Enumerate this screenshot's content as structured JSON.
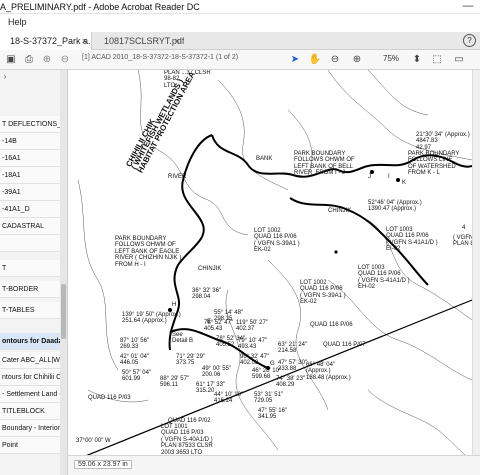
{
  "window": {
    "title": "A_PRELIMINARY.pdf - Adobe Acrobat Reader DC"
  },
  "menu": {
    "help": "Help"
  },
  "tabs": [
    {
      "label": "18-S-37372_Park a..."
    },
    {
      "label": "10817SCLSRYT.pdf"
    }
  ],
  "toolbar": {
    "doc_label": "[1] ACAD 2010_18-S-37372-18-S-37372-1 (1 of 2)",
    "zoom": "75%"
  },
  "bookmarks": [
    "T DEFLECTIONS_COO",
    "-14B",
    "-16A1",
    "-18A1",
    "-39A1",
    "-41A1_D",
    "CADASTRAL",
    "",
    "T",
    "T-BORDER",
    "T-TABLES",
    "ontours for Daadzai",
    "Cater ABC_ALL|Wat",
    "ntours for Chihilii C",
    "- Settlement Land -",
    "TITLEBLOCK",
    "Boundary - Interior",
    "Point"
  ],
  "map": {
    "labels": {
      "plan_top": "PLAN ...37 CLSR\n98-82\nLTO",
      "chihilii": "CHIHILII CHIK\n( WHITEFISH WETLANDS )\nHABITAT PROTECTION AREA",
      "bank": "BANK",
      "river": "RIVER",
      "chinjik": "CHINJIK",
      "chinjik2": "CHINJIK",
      "park_right_bank": "PARK BOUNDARY\nFOLLOWS OHWM OF\nLEFT BANK OF BELL\nRIVER  FROM I - J",
      "park_watershed": "PARK BOUNDARY\nFOLLOWS LINE\nOF WATERSHED\nFROM K - L",
      "park_eagle": "PARK BOUNDARY\nFOLLOWS OHWM OF\nLEFT BANK OF EAGLE\nRIVER ( CHIZHIN NJIK )\nFROM H - I",
      "lot1002": "LOT 1002\nQUAD 116 P/06\n( VGFN S-39A1 )\nEK-02",
      "lot1003": "LOT 1003\nQUAD 116 P/06\n( VGFN S-41A1/D )\nEI-02",
      "lot1003b": "LOT 1003\nQUAD 116 P/06\n( VGFN S-41A1/D )\nEH-02",
      "lot1002b": "LOT 1002\nQUAD 116 P/06\n( VGFN S-39A1 )\nEK-02",
      "lot1001": "LOT 1001\nQUAD 116 P/03\n( VGFN S-40A1/D )\nPLAN 87533 CLSR\n2003 3653 LTO",
      "quad116p06": "QUAD 116 P/06",
      "quad116p07": "QUAD 116 P/07",
      "quad116p03": "QUAD 116 P/03",
      "quad116p02": "QUAD 116 P/02",
      "lat_37": "37°00' 00\" W",
      "bearing1": "21°30' 34\" (Approx.)\n4847.83\n42.97",
      "bearing2": "52°46' 04\" (Approx.)\n1390.47 (Approx.)",
      "right_lot": "( VGFN\nPLAN 8138",
      "right_num": "4",
      "station_j": "J",
      "station_i": "I",
      "station_k": "K",
      "station_h": "H",
      "station_g": "G",
      "station_e": "E",
      "bearings_cluster": "139° 19' 50\" (Approx.)\n251.64 (Approx.)",
      "dist_a": "36° 32' 36\"\n298.04",
      "dist_b": "55° 14' 48\"\n298.15",
      "dist_c": "78° 52' 47\"\n405.43",
      "dist_d": "119° 50' 27\"\n402.37",
      "dist_e": "87° 10' 56\"\n269.33",
      "dist_f": "42° 01' 04\"\n446.05",
      "dist_g": "50° 57' 04\"\n601.99",
      "dist_h": "71° 29' 29\"\n373.75",
      "dist_i": "49° 00' 55\"\n200.06",
      "dist_j": "61° 17' 33\"\n315.20",
      "dist_k": "44° 10' 10\"\n416.24",
      "dist_l": "53° 31' 51\"\n729.05",
      "dist_m": "47° 55' 16\"\n341.95",
      "dist_n": "79° 10' 47\"\n493.43",
      "dist_o": "88° 29' 57\"\n596.11",
      "dist_p": "96° 32' 47\"\n402.08",
      "dist_q": "63° 21' 24\"\n214.58",
      "dist_r": "47° 57' 30\"\n233.88",
      "dist_s": "66° 48' 04\"\n(Approx.)\n188.48 (Approx.)",
      "dist_t": "46° 28' 10\"\n599.68",
      "dist_u": "74° 38' 23\"\n408.29",
      "dist_v": "78° 52' 34\"\n405.52",
      "detail_b": "See\nDetail B"
    }
  },
  "status": {
    "page_size": "59.06 x 23.97 in"
  }
}
